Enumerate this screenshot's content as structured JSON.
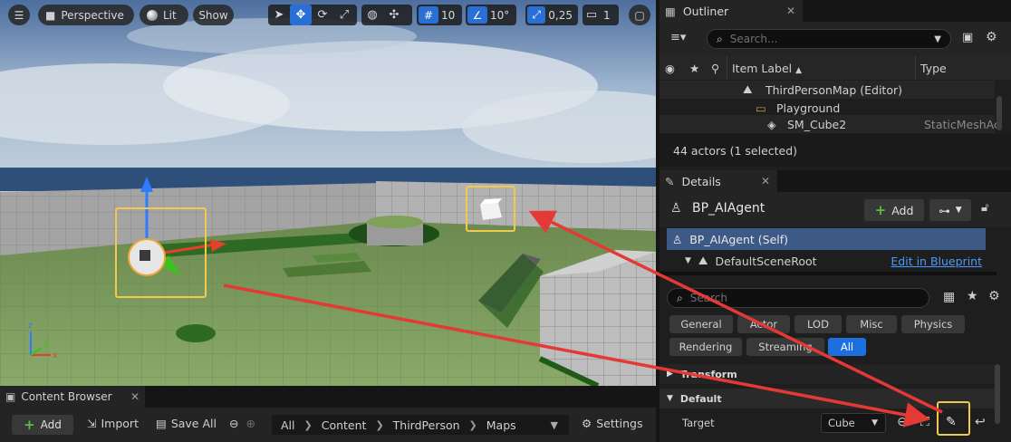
{
  "viewport": {
    "perspective_label": "Perspective",
    "lit_label": "Lit",
    "show_label": "Show",
    "grid_snap_value": "10",
    "rotation_snap_value": "10°",
    "scale_snap_value": "0,25",
    "camera_speed_value": "1"
  },
  "content_browser": {
    "tab_label": "Content Browser",
    "add_label": "Add",
    "import_label": "Import",
    "save_all_label": "Save All",
    "path": [
      "All",
      "Content",
      "ThirdPerson",
      "Maps"
    ],
    "settings_label": "Settings"
  },
  "outliner": {
    "tab_label": "Outliner",
    "search_placeholder": "Search...",
    "col_item_label": "Item Label",
    "col_type": "Type",
    "rows": [
      {
        "label": "ThirdPersonMap (Editor)",
        "type": ""
      },
      {
        "label": "Playground",
        "type": ""
      },
      {
        "label": "SM_Cube2",
        "type": "StaticMeshAc"
      }
    ],
    "actor_count": "44 actors (1 selected)"
  },
  "details": {
    "tab_label": "Details",
    "actor_name": "BP_AIAgent",
    "add_label": "Add",
    "components": [
      {
        "label": "BP_AIAgent (Self)"
      },
      {
        "label": "DefaultSceneRoot",
        "link": "Edit in Blueprint"
      }
    ],
    "search_placeholder": "Search",
    "filters_row1": [
      "General",
      "Actor",
      "LOD",
      "Misc",
      "Physics"
    ],
    "filters_row2": [
      "Rendering",
      "Streaming",
      "All"
    ],
    "active_filter": "All",
    "sections": {
      "transform": "Transform",
      "default": "Default"
    },
    "target_label": "Target",
    "target_value": "Cube"
  },
  "colors": {
    "accent_blue": "#1d6fe0",
    "highlight_yellow": "#f2c94c",
    "annotation_red": "#e53935",
    "add_green": "#5bbf3d"
  }
}
